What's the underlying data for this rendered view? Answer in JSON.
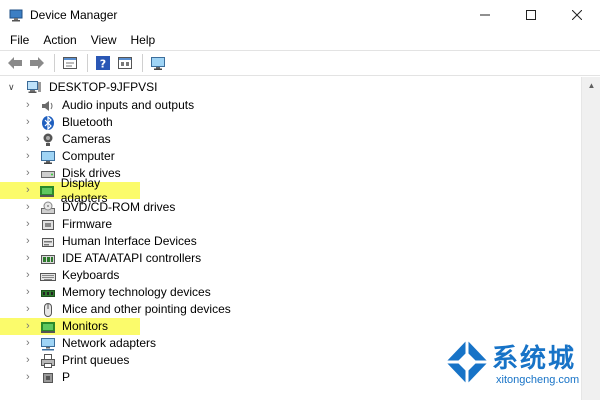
{
  "window": {
    "title": "Device Manager",
    "controls": [
      "minimize",
      "maximize",
      "close"
    ]
  },
  "menu": [
    {
      "label": "File"
    },
    {
      "label": "Action"
    },
    {
      "label": "View"
    },
    {
      "label": "Help"
    }
  ],
  "toolbar": {
    "buttons": [
      "back-arrow-icon",
      "forward-arrow-icon",
      "properties-icon",
      "help-icon",
      "show-hidden-icon",
      "monitor-icon"
    ]
  },
  "tree": {
    "root": {
      "label": "DESKTOP-9JFPVSI",
      "expanded": true
    },
    "items": [
      {
        "label": "Audio inputs and outputs",
        "icon": "speaker-icon",
        "highlighted": false
      },
      {
        "label": "Bluetooth",
        "icon": "bluetooth-icon",
        "highlighted": false
      },
      {
        "label": "Cameras",
        "icon": "camera-icon",
        "highlighted": false
      },
      {
        "label": "Computer",
        "icon": "computer-icon",
        "highlighted": false
      },
      {
        "label": "Disk drives",
        "icon": "disk-drive-icon",
        "highlighted": false
      },
      {
        "label": "Display adapters",
        "icon": "display-adapter-icon",
        "highlighted": true
      },
      {
        "label": "DVD/CD-ROM drives",
        "icon": "dvd-drive-icon",
        "highlighted": false
      },
      {
        "label": "Firmware",
        "icon": "firmware-icon",
        "highlighted": false
      },
      {
        "label": "Human Interface Devices",
        "icon": "hid-icon",
        "highlighted": false
      },
      {
        "label": "IDE ATA/ATAPI controllers",
        "icon": "ide-controller-icon",
        "highlighted": false
      },
      {
        "label": "Keyboards",
        "icon": "keyboard-icon",
        "highlighted": false
      },
      {
        "label": "Memory technology devices",
        "icon": "memory-icon",
        "highlighted": false
      },
      {
        "label": "Mice and other pointing devices",
        "icon": "mouse-icon",
        "highlighted": false
      },
      {
        "label": "Monitors",
        "icon": "monitor-icon",
        "highlighted": true
      },
      {
        "label": "Network adapters",
        "icon": "network-adapter-icon",
        "highlighted": false
      },
      {
        "label": "Print queues",
        "icon": "printer-icon",
        "highlighted": false
      },
      {
        "label": "P",
        "icon": "processor-icon",
        "highlighted": false
      }
    ]
  },
  "watermark": {
    "text": "系统城",
    "url": "xitongcheng.com"
  },
  "colors": {
    "highlight": "#fbfb6b",
    "accent": "#1773c7"
  }
}
